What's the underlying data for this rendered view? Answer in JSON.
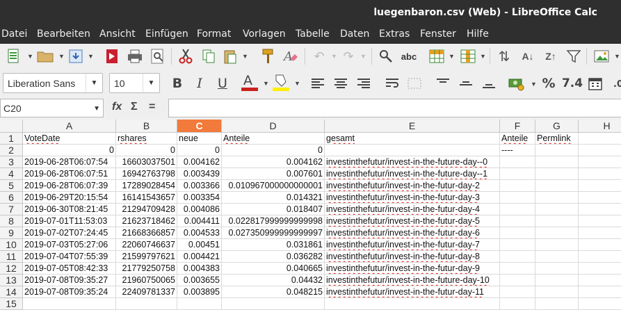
{
  "window": {
    "title": "luegenbaron.csv (Web) - LibreOffice Calc"
  },
  "menu": [
    "Datei",
    "Bearbeiten",
    "Ansicht",
    "Einfügen",
    "Format",
    "Vorlagen",
    "Tabelle",
    "Daten",
    "Extras",
    "Fenster",
    "Hilfe"
  ],
  "toolbar": {
    "font_name": "Liberation Sans",
    "font_size": "10",
    "bold": "B",
    "italic": "I",
    "underline": "U",
    "percent": "%",
    "number_format": "7.4",
    "sum": "Σ",
    "equals": "=",
    "function_wizard": "fx"
  },
  "formula_bar": {
    "cell_ref": "C20",
    "content": ""
  },
  "sheet": {
    "active_column": "C",
    "columns": [
      "A",
      "B",
      "C",
      "D",
      "E",
      "F",
      "G",
      "H"
    ],
    "row_numbers": [
      "1",
      "2",
      "3",
      "4",
      "5",
      "6",
      "7",
      "8",
      "9",
      "10",
      "11",
      "12",
      "13",
      "14",
      "15"
    ],
    "rows": [
      [
        "VoteDate",
        "rshares",
        "neue",
        "Anteile",
        "gesamt",
        "Anteile",
        "Permlink",
        ""
      ],
      [
        "0",
        "0",
        "0",
        "0",
        "",
        "----",
        "",
        ""
      ],
      [
        "2019-06-28T06:07:54",
        "16603037501",
        "0.004162",
        "0.004162",
        "investinthefutur/invest-in-the-future-day--0",
        "",
        "",
        ""
      ],
      [
        "2019-06-28T06:07:51",
        "16942763798",
        "0.003439",
        "0.007601",
        "investinthefutur/invest-in-the-future-day--1",
        "",
        "",
        ""
      ],
      [
        "2019-06-28T06:07:39",
        "17289028454",
        "0.003366",
        "0.010967000000000001",
        "investinthefutur/invest-in-the-futur-day-2",
        "",
        "",
        ""
      ],
      [
        "2019-06-29T20:15:54",
        "16141543657",
        "0.003354",
        "0.014321",
        "investinthefutur/invest-in-the-futur-day-3",
        "",
        "",
        ""
      ],
      [
        "2019-06-30T08:21:45",
        "21294709428",
        "0.004086",
        "0.018407",
        "investinthefutur/invest-in-the-futur-day-4",
        "",
        "",
        ""
      ],
      [
        "2019-07-01T11:53:03",
        "21623718462",
        "0.004411",
        "0.022817999999999998",
        "investinthefutur/invest-in-the-futur-day-5",
        "",
        "",
        ""
      ],
      [
        "2019-07-02T07:24:45",
        "21668366857",
        "0.004533",
        "0.027350999999999997",
        "investinthefutur/invest-in-the-futur-day-6",
        "",
        "",
        ""
      ],
      [
        "2019-07-03T05:27:06",
        "22060746637",
        "0.00451",
        "0.031861",
        "investinthefutur/invest-in-the-futur-day-7",
        "",
        "",
        ""
      ],
      [
        "2019-07-04T07:55:39",
        "21599797621",
        "0.004421",
        "0.036282",
        "investinthefutur/invest-in-the-futur-day-8",
        "",
        "",
        ""
      ],
      [
        "2019-07-05T08:42:33",
        "21779250758",
        "0.004383",
        "0.040665",
        "investinthefutur/invest-in-the-futur-day-9",
        "",
        "",
        ""
      ],
      [
        "2019-07-08T09:35:27",
        "21960750065",
        "0.003655",
        "0.04432",
        "investinthefutur/invest-in-the-future-day-10",
        "",
        "",
        ""
      ],
      [
        "2019-07-08T09:35:24",
        "22409781337",
        "0.003895",
        "0.048215",
        "investinthefutur/invest-in-the-futur-day-11",
        "",
        "",
        ""
      ],
      [
        "",
        "",
        "",
        "",
        "",
        "",
        "",
        ""
      ]
    ]
  },
  "colors": {
    "active_header": "#f27a3a",
    "titlebar": "#2f2f2f",
    "spell_underline": "#e02020"
  }
}
